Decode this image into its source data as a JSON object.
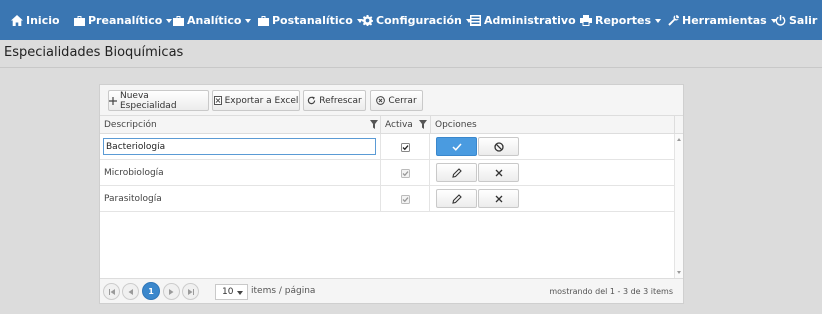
{
  "nav": {
    "items": [
      {
        "label": "Inicio",
        "icon": "home-icon"
      },
      {
        "label": "Preanalítico",
        "icon": "briefcase-icon",
        "dropdown": true
      },
      {
        "label": "Analítico",
        "icon": "briefcase-icon",
        "dropdown": true
      },
      {
        "label": "Postanalítico",
        "icon": "briefcase-icon",
        "dropdown": true
      },
      {
        "label": "Configuración",
        "icon": "gear-icon",
        "dropdown": true
      },
      {
        "label": "Administrativo",
        "icon": "list-icon",
        "dropdown": true
      },
      {
        "label": "Reportes",
        "icon": "print-icon",
        "dropdown": true
      },
      {
        "label": "Herramientas",
        "icon": "wrench-icon",
        "dropdown": true
      },
      {
        "label": "Salir",
        "icon": "power-icon"
      }
    ],
    "bar_color": "#3a76b2"
  },
  "page": {
    "title": "Especialidades Bioquímicas"
  },
  "toolbar": {
    "new_label": "Nueva Especialidad",
    "excel_label": "Exportar a Excel",
    "refresh_label": "Refrescar",
    "close_label": "Cerrar"
  },
  "table": {
    "columns": {
      "descripcion": "Descripción",
      "activa": "Activa",
      "opciones": "Opciones"
    },
    "rows": [
      {
        "descripcion": "Bacteriología",
        "activa": true,
        "editing": true
      },
      {
        "descripcion": "Microbiología",
        "activa": true,
        "editing": false
      },
      {
        "descripcion": "Parasitología",
        "activa": true,
        "editing": false
      }
    ]
  },
  "pager": {
    "current_page": "1",
    "page_size": "10",
    "items_label": "items / página",
    "info": "mostrando del 1 - 3 de 3 items"
  },
  "colors": {
    "accent": "#4a9be0"
  }
}
